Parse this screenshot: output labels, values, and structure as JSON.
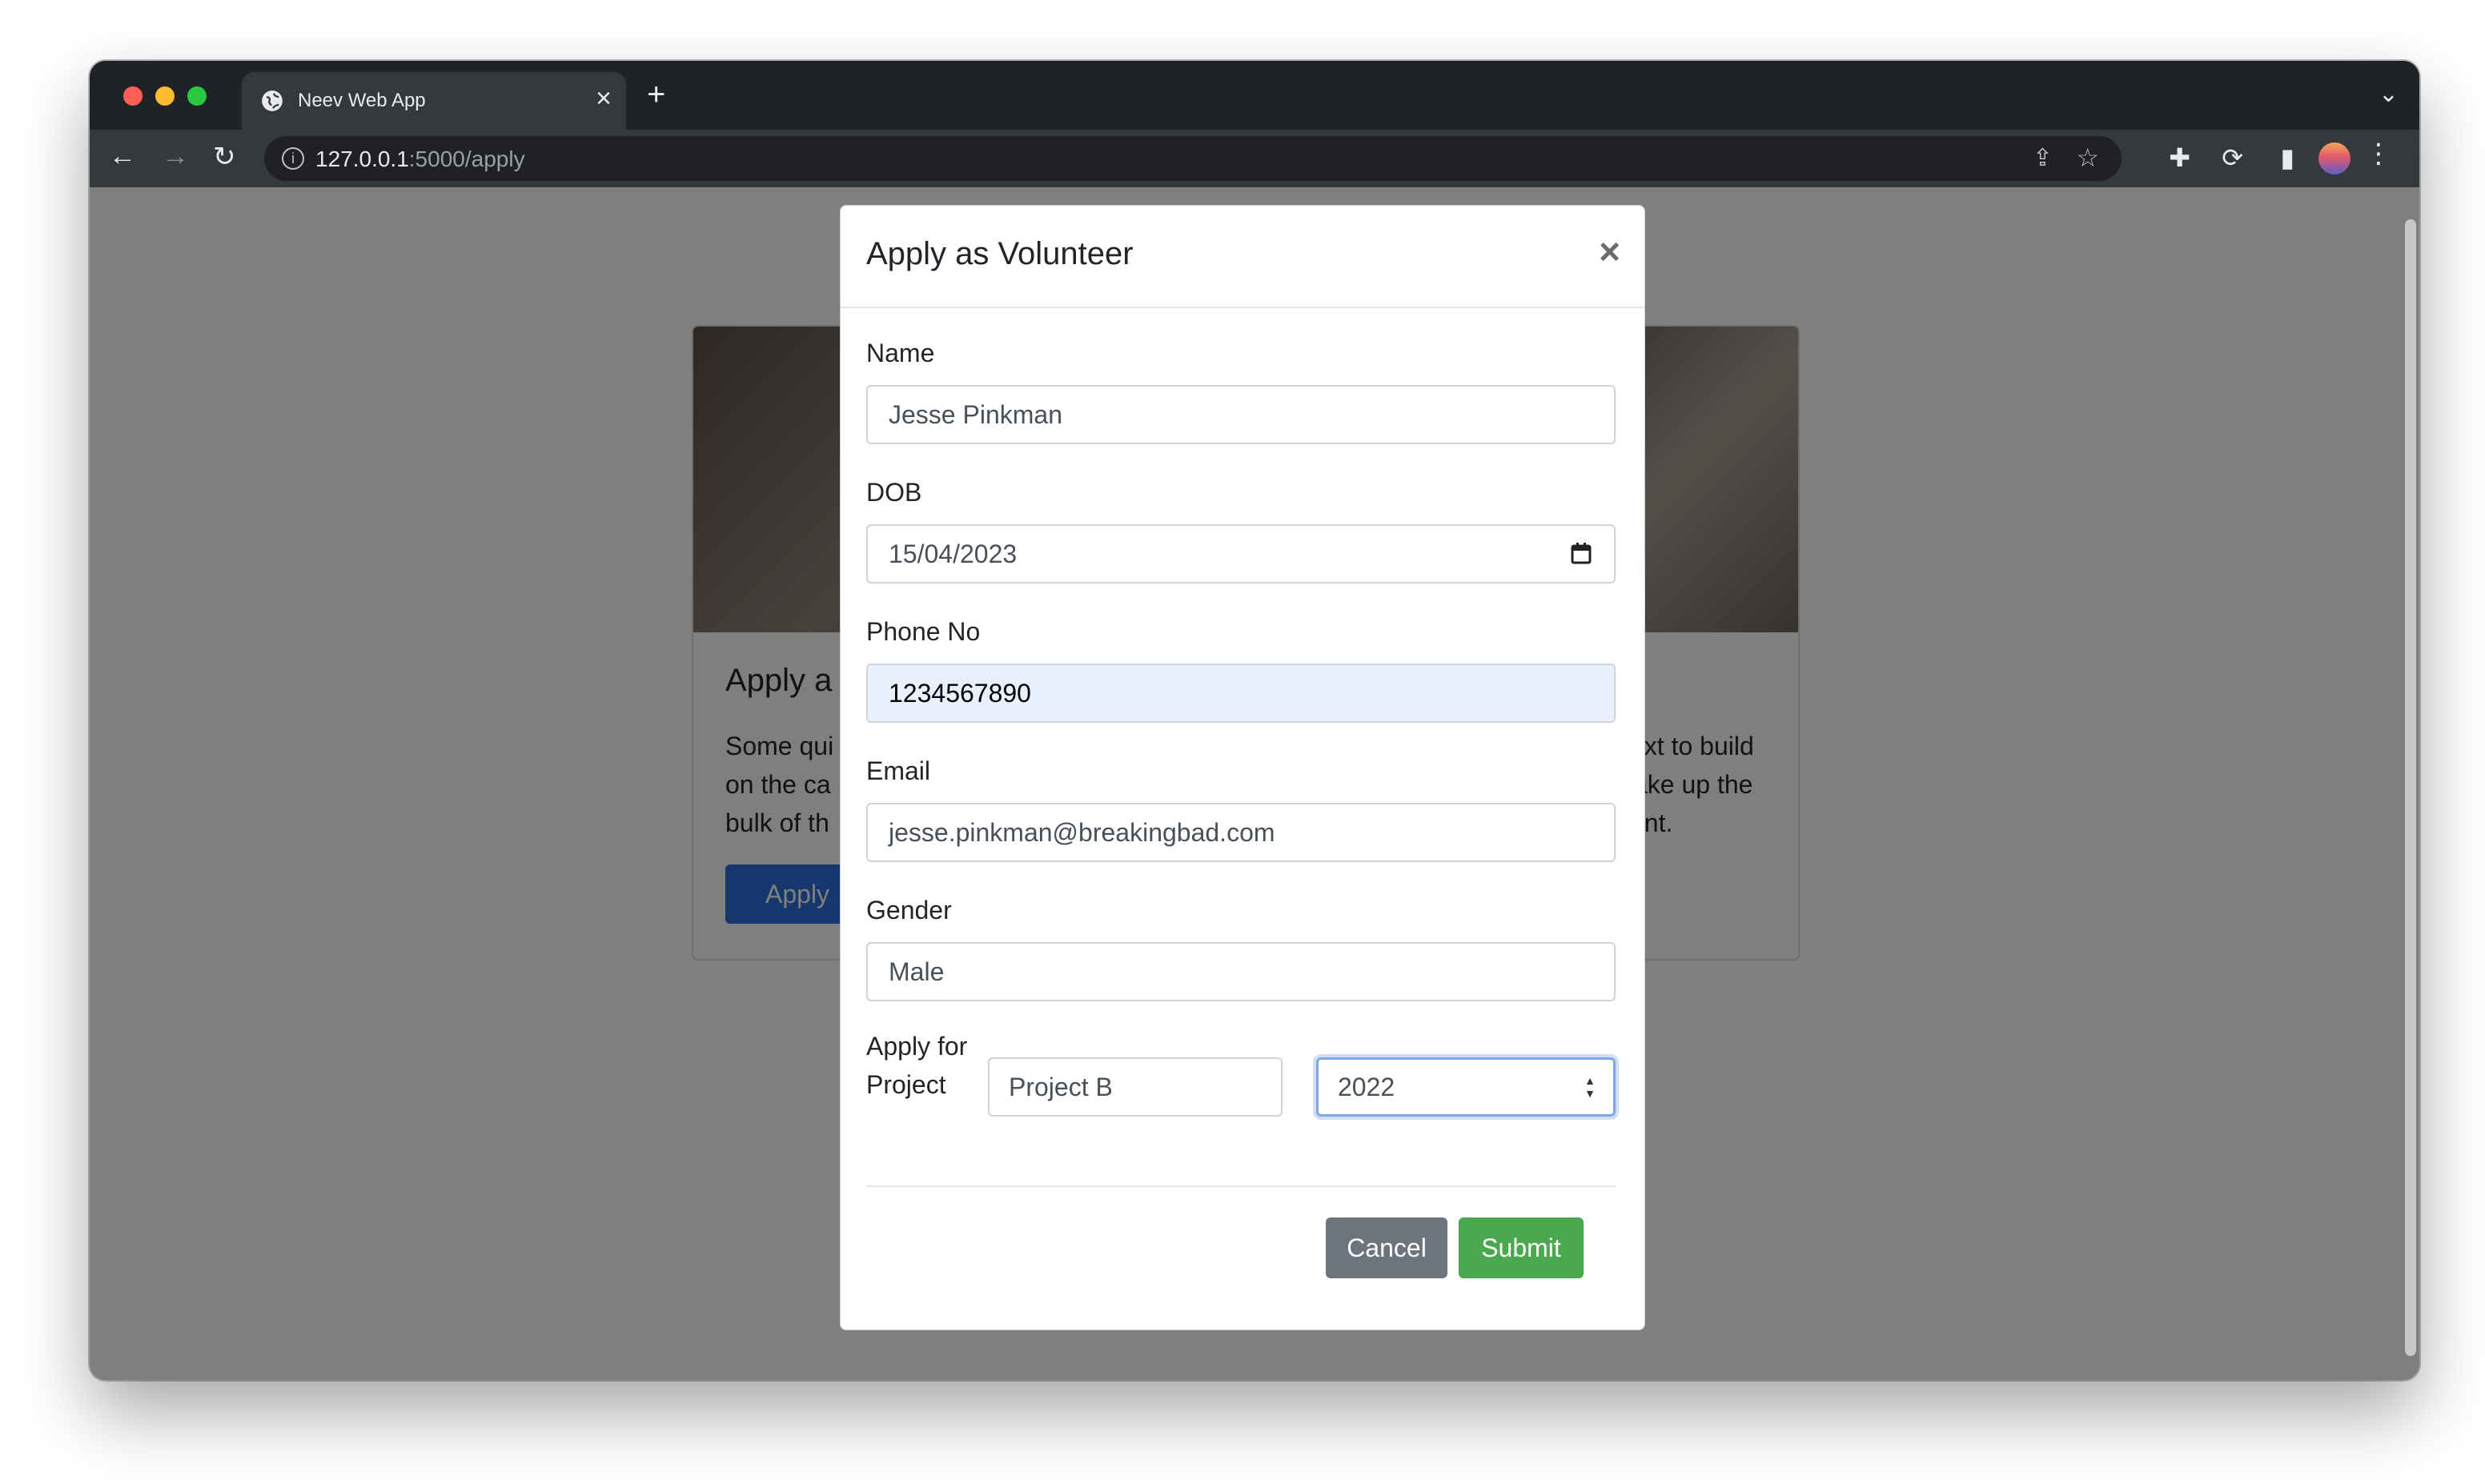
{
  "browser": {
    "tab_title": "Neev Web App",
    "new_tab_label": "+",
    "url_host": "127.0.0.1",
    "url_path": ":5000/apply"
  },
  "card": {
    "title_visible": "Apply a",
    "text_line1_left": "Some qui",
    "text_line2_left": "on the ca",
    "text_line3_left": "bulk of th",
    "text_line1_right": "ext to build",
    "text_line2_right": "ake up the",
    "text_line3_right": "ent.",
    "button_label": "Apply"
  },
  "modal": {
    "title": "Apply as Volunteer",
    "close_label": "×",
    "name_label": "Name",
    "name_value": "Jesse Pinkman",
    "dob_label": "DOB",
    "dob_value": "15/04/2023",
    "phone_label": "Phone No",
    "phone_value": "1234567890",
    "email_label": "Email",
    "email_value": "jesse.pinkman@breakingbad.com",
    "gender_label": "Gender",
    "gender_value": "Male",
    "apply_label": "Apply for Project",
    "project_value": "Project B",
    "year_value": "2022",
    "cancel_label": "Cancel",
    "submit_label": "Submit"
  },
  "colors": {
    "submit": "#4aa84f",
    "cancel": "#6c757d",
    "autofill": "#e8f0fe"
  }
}
